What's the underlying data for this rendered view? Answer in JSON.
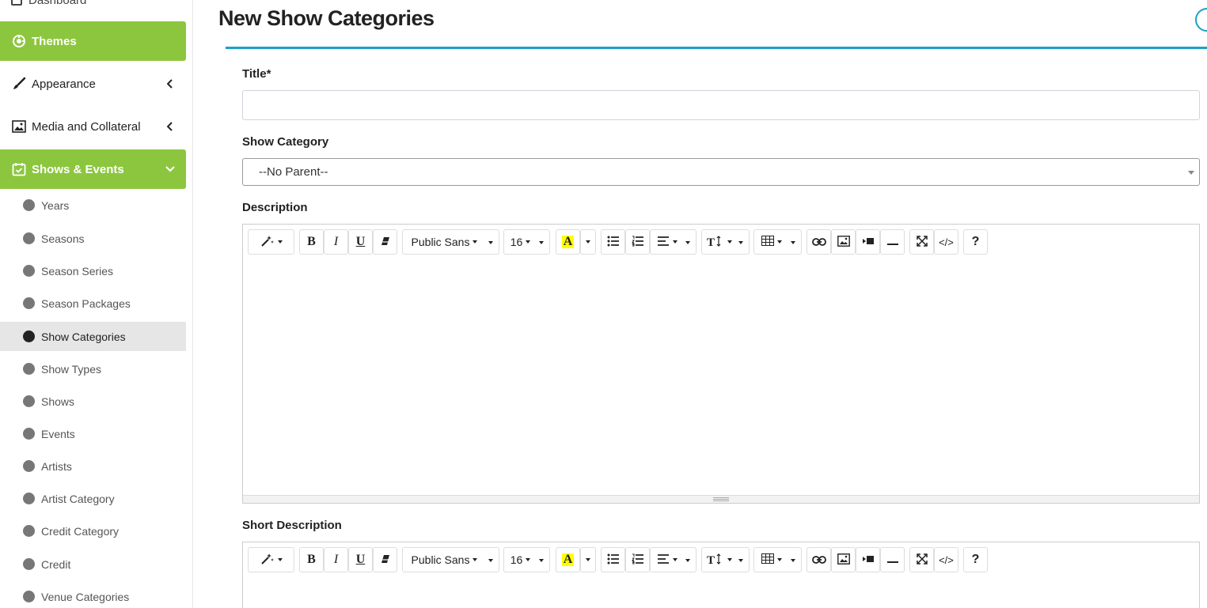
{
  "sidebar": {
    "top_cut_label": "Dashboard",
    "items": [
      {
        "label": "Themes",
        "active": true
      },
      {
        "label": "Appearance"
      },
      {
        "label": "Media and Collateral"
      },
      {
        "label": "Shows & Events",
        "active": true,
        "expanded": true
      }
    ],
    "sub_items": [
      {
        "label": "Years"
      },
      {
        "label": "Seasons"
      },
      {
        "label": "Season Series"
      },
      {
        "label": "Season Packages"
      },
      {
        "label": "Show Categories",
        "current": true
      },
      {
        "label": "Show Types"
      },
      {
        "label": "Shows"
      },
      {
        "label": "Events"
      },
      {
        "label": "Artists"
      },
      {
        "label": "Artist Category"
      },
      {
        "label": "Credit Category"
      },
      {
        "label": "Credit"
      },
      {
        "label": "Venue Categories"
      }
    ],
    "active_color": "#8cc63f"
  },
  "page": {
    "title": "New Show Categories",
    "accent_color": "#1ba0c9"
  },
  "form": {
    "title_label": "Title*",
    "title_value": "",
    "show_category_label": "Show Category",
    "show_category_value": "--No Parent--",
    "description_label": "Description",
    "short_description_label": "Short Description"
  },
  "editor_toolbar": {
    "font_name": "Public Sans",
    "font_size": "16",
    "highlight_letter": "A",
    "bold": "B",
    "italic": "I",
    "underline": "U",
    "help": "?",
    "code": "</>"
  }
}
